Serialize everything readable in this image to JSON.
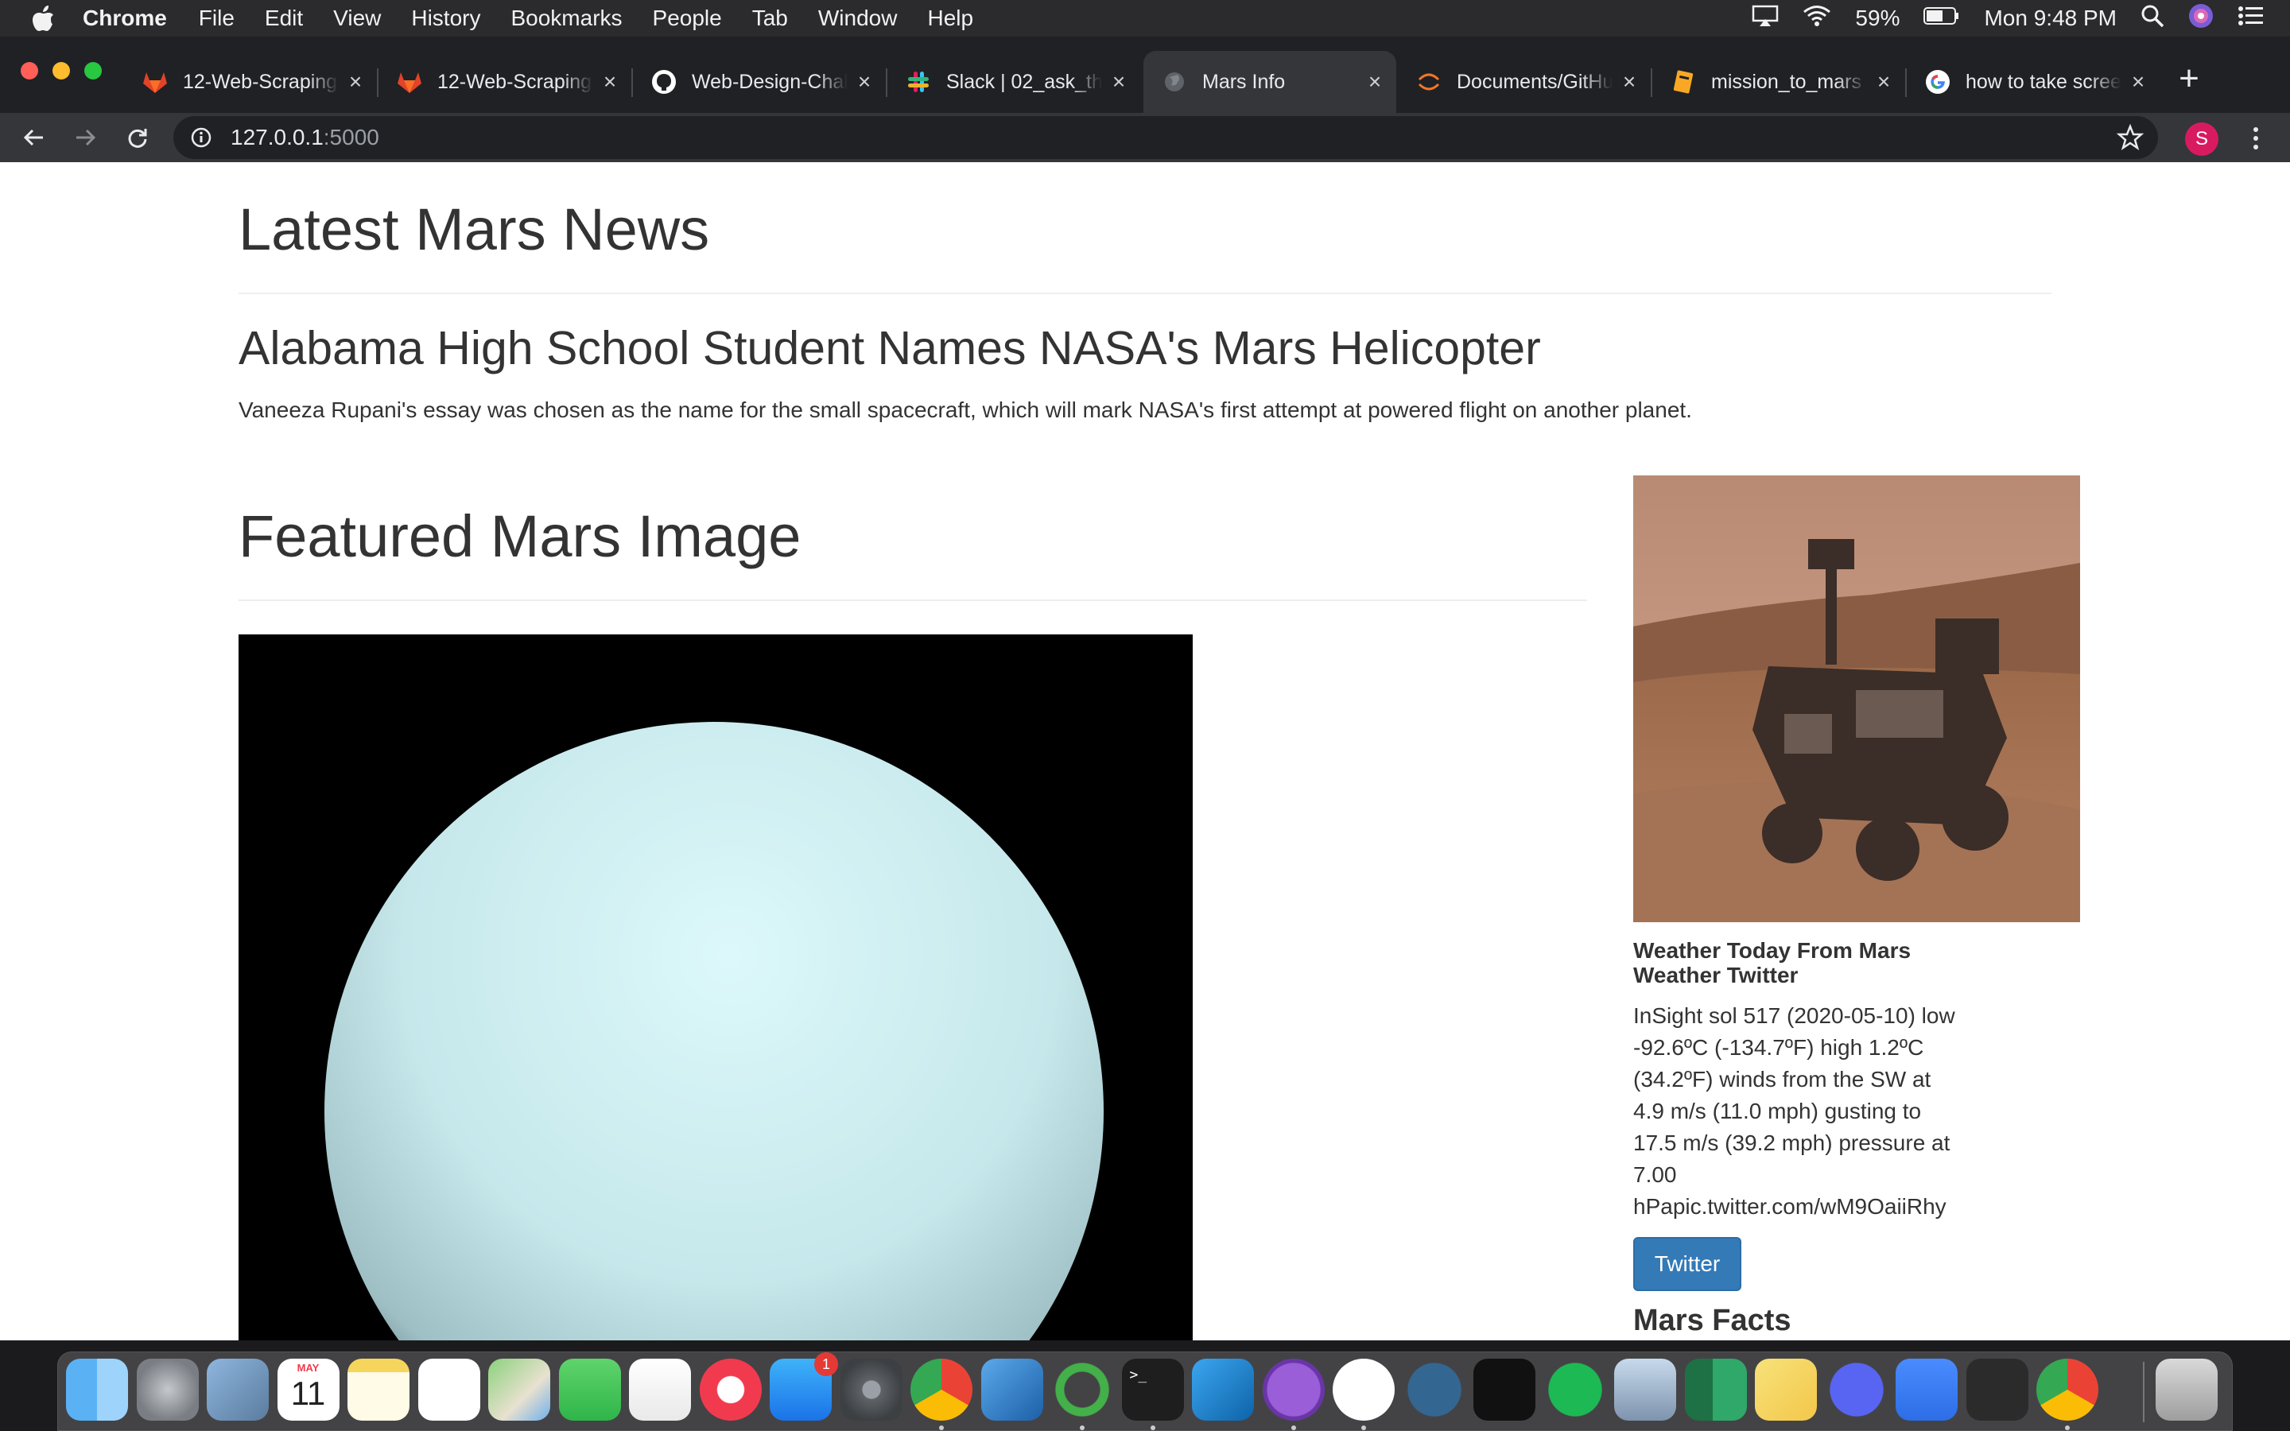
{
  "menubar": {
    "app_name": "Chrome",
    "menus": [
      "File",
      "Edit",
      "View",
      "History",
      "Bookmarks",
      "People",
      "Tab",
      "Window",
      "Help"
    ],
    "battery": "59%",
    "clock": "Mon 9:48 PM"
  },
  "tabs": [
    {
      "label": "12-Web-Scraping-",
      "icon": "gitlab-icon"
    },
    {
      "label": "12-Web-Scraping-",
      "icon": "gitlab-icon"
    },
    {
      "label": "Web-Design-Chall",
      "icon": "github-icon"
    },
    {
      "label": "Slack | 02_ask_the",
      "icon": "slack-icon"
    },
    {
      "label": "Mars Info",
      "icon": "globe-icon",
      "active": true
    },
    {
      "label": "Documents/GitHub",
      "icon": "jupyter-icon"
    },
    {
      "label": "mission_to_mars",
      "icon": "notebook-icon"
    },
    {
      "label": "how to take scree",
      "icon": "google-icon"
    }
  ],
  "address_bar": {
    "host": "127.0.0.1",
    "port": ":5000"
  },
  "profile_initial": "S",
  "page": {
    "news_heading": "Latest Mars News",
    "news_title": "Alabama High School Student Names NASA's Mars Helicopter",
    "news_paragraph": "Vaneeza Rupani's essay was chosen as the name for the small spacecraft, which will mark NASA's first attempt at powered flight on another planet.",
    "featured_heading": "Featured Mars Image",
    "weather_title": "Weather Today From Mars Weather Twitter",
    "weather_text": "InSight sol 517 (2020-05-10) low -92.6ºC (-134.7ºF) high 1.2ºC (34.2ºF) winds from the SW at 4.9 m/s (11.0 mph) gusting to 17.5 m/s (39.2 mph) pressure at 7.00 hPapic.twitter.com/wM9OaiiRhy",
    "twitter_button": "Twitter",
    "facts_heading": "Mars Facts"
  },
  "dock": {
    "calendar_month": "MAY",
    "calendar_day": "11",
    "app_store_badge": "1",
    "apps": [
      "finder-icon",
      "launchpad-icon",
      "preview-icon",
      "calendar-icon",
      "notes-icon",
      "reminders-icon",
      "maps-icon",
      "messages-icon",
      "numbers-icon",
      "news-icon",
      "app-store-icon",
      "system-preferences-icon",
      "chrome-icon",
      "xcode-icon",
      "anaconda-icon",
      "terminal-icon",
      "vscode-icon",
      "github-desktop-icon",
      "mongodb-icon",
      "postgres-icon",
      "apple-tv-icon",
      "spotify-icon",
      "image-capture-icon",
      "excel-icon",
      "stickies-icon",
      "discord-icon",
      "zoom-icon",
      "activity-monitor-icon",
      "chrome-icon",
      "trash-icon"
    ]
  }
}
